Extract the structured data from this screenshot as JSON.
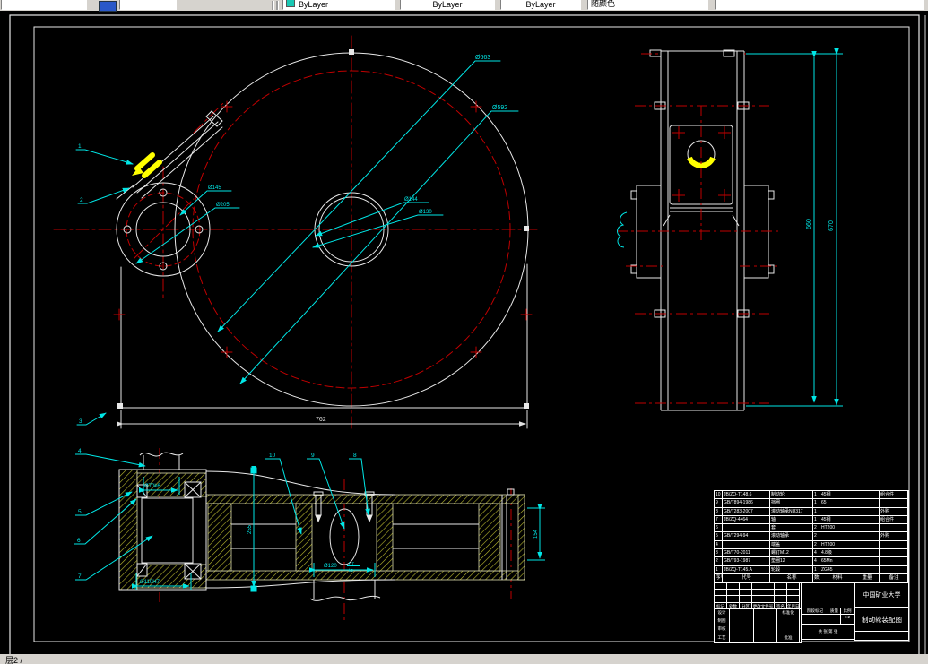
{
  "toolbar": {
    "color_value": "ByLayer",
    "linetype_value": "ByLayer",
    "lineweight_value": "ByLayer",
    "plot_style_value": "随颜色"
  },
  "statusbar": {
    "layer_label": "层2 /"
  },
  "front_view": {
    "dia_outer": "Ø663",
    "dia_pitch": "Ø592",
    "dia_hub": "Ø144",
    "dia_bore": "Ø130",
    "dia_flange_bore": "Ø145",
    "dia_flange": "Ø205",
    "width": "762",
    "balloon_1": "1",
    "balloon_2": "2",
    "balloon_3": "3"
  },
  "side_view": {
    "height_inner": "660",
    "height_outer": "670"
  },
  "section_view": {
    "shaft_fit": "Ø70k6",
    "bore_fit": "Ø110H7",
    "depth": "255",
    "hub_dia": "Ø120",
    "hub_fit_top": "H7",
    "hub_fit_bottom": "k6",
    "right_width": "154",
    "balloon_4": "4",
    "balloon_5": "5",
    "balloon_6": "6",
    "balloon_7": "7",
    "balloon_8": "8",
    "balloon_9": "9",
    "balloon_10": "10"
  },
  "bom": {
    "headers": [
      "序号",
      "代号",
      "名称",
      "数量",
      "材料",
      "重量",
      "备注"
    ],
    "rows": [
      {
        "no": "10",
        "code": "JB/ZQ-T148.6",
        "name": "制动轮",
        "qty": "1",
        "material": "45钢",
        "weight": "",
        "remark": "组合件"
      },
      {
        "no": "9",
        "code": "GB/T894-1986",
        "name": "挡圈",
        "qty": "1",
        "material": "65",
        "weight": "",
        "remark": ""
      },
      {
        "no": "8",
        "code": "GB/T283-2007",
        "name": "滚动轴承NU317",
        "qty": "1",
        "material": "",
        "weight": "",
        "remark": "外购"
      },
      {
        "no": "7",
        "code": "JB/ZQ-4464",
        "name": "轴",
        "qty": "1",
        "material": "45钢",
        "weight": "",
        "remark": "组合件"
      },
      {
        "no": "6",
        "code": "",
        "name": "套",
        "qty": "2",
        "material": "HT200",
        "weight": "",
        "remark": ""
      },
      {
        "no": "5",
        "code": "GB/T294-94",
        "name": "滚动轴承",
        "qty": "2",
        "material": "",
        "weight": "",
        "remark": "外购"
      },
      {
        "no": "4",
        "code": "",
        "name": "端盖",
        "qty": "2",
        "material": "HT200",
        "weight": "",
        "remark": ""
      },
      {
        "no": "3",
        "code": "GB/T70-2011",
        "name": "螺钉M12",
        "qty": "4",
        "material": "4.8级",
        "weight": "",
        "remark": ""
      },
      {
        "no": "2",
        "code": "GB/T93-1987",
        "name": "垫圈12",
        "qty": "4",
        "material": "65Mn",
        "weight": "",
        "remark": ""
      },
      {
        "no": "1",
        "code": "JB/ZQ-T145.A",
        "name": "轮毂",
        "qty": "1",
        "material": "ZG45",
        "weight": "",
        "remark": ""
      }
    ]
  },
  "title_block": {
    "org": "中国矿业大学",
    "drawing_title": "制动轮装配图",
    "revision_header": [
      "标记",
      "处数",
      "分区",
      "更改文件号",
      "签名",
      "年月日"
    ],
    "sign_rows": [
      [
        "设计",
        "",
        "",
        "标准化"
      ],
      [
        "制图",
        "",
        "",
        ""
      ],
      [
        "审核",
        "",
        "",
        ""
      ],
      [
        "工艺",
        "",
        "",
        "批准"
      ]
    ],
    "stage_label": "阶段标记",
    "mass_label": "质量",
    "scale_label": "比例",
    "scale_value": "1:2",
    "sheet_info": "共 张 第 张"
  }
}
